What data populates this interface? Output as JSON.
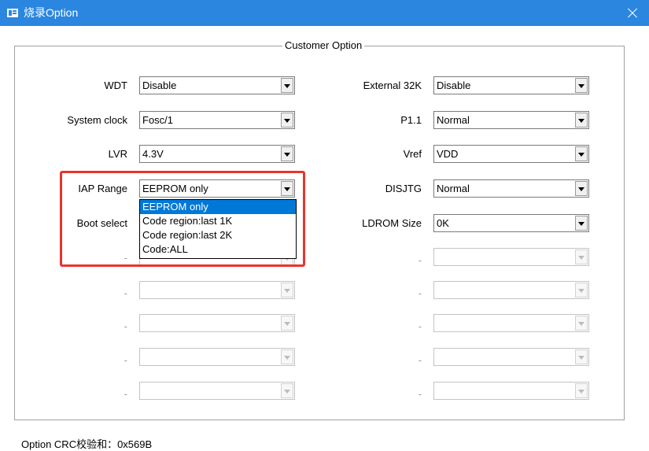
{
  "window": {
    "title": "烧录Option"
  },
  "group": {
    "title": "Customer Option"
  },
  "left_fields": [
    {
      "label": "WDT",
      "value": "Disable"
    },
    {
      "label": "System clock",
      "value": "Fosc/1"
    },
    {
      "label": "LVR",
      "value": "4.3V"
    },
    {
      "label": "IAP Range",
      "value": "EEPROM only"
    },
    {
      "label": "Boot select",
      "value": ""
    },
    {
      "label": "-",
      "value": ""
    },
    {
      "label": "-",
      "value": ""
    },
    {
      "label": "-",
      "value": ""
    },
    {
      "label": "-",
      "value": ""
    },
    {
      "label": "-",
      "value": ""
    }
  ],
  "right_fields": [
    {
      "label": "External 32K",
      "value": "Disable"
    },
    {
      "label": "P1.1",
      "value": "Normal"
    },
    {
      "label": "Vref",
      "value": "VDD"
    },
    {
      "label": "DISJTG",
      "value": "Normal"
    },
    {
      "label": "LDROM Size",
      "value": "0K"
    },
    {
      "label": "-",
      "value": ""
    },
    {
      "label": "-",
      "value": ""
    },
    {
      "label": "-",
      "value": ""
    },
    {
      "label": "-",
      "value": ""
    },
    {
      "label": "-",
      "value": ""
    }
  ],
  "iap_dropdown": {
    "options": [
      "EEPROM only",
      "Code region:last 1K",
      "Code region:last 2K",
      "Code:ALL"
    ],
    "selected_index": 0
  },
  "footer": {
    "crc_text": "Option CRC校验和：0x569B"
  },
  "colors": {
    "titlebar": "#2b86e0",
    "selection": "#0078d7",
    "highlight_border": "#e8342e"
  },
  "icons": {
    "window": "app-window-icon",
    "close": "close-icon",
    "combo_arrow": "chevron-down-icon"
  }
}
